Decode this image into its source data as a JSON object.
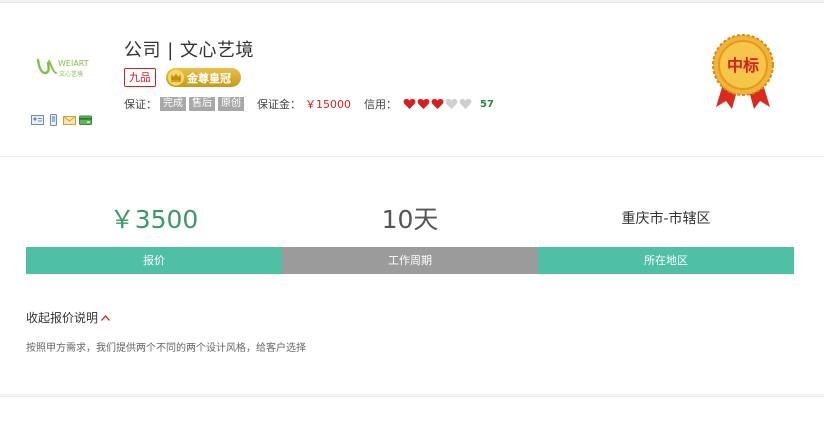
{
  "company": {
    "title": "公司 | 文心艺境",
    "logo_text": "WEIART",
    "logo_subtext": "文心艺境",
    "rank_badge": "九品",
    "crown_badge": "金尊皇冠",
    "icons": [
      "id-card-icon",
      "phone-icon",
      "email-icon",
      "bank-card-icon"
    ]
  },
  "guarantee": {
    "label": "保证：",
    "tags": [
      "完成",
      "售后",
      "原创"
    ]
  },
  "deposit": {
    "label": "保证金：",
    "value": "￥15000"
  },
  "credit": {
    "label": "信用：",
    "filled_hearts": 3,
    "total_hearts": 5,
    "score": "57"
  },
  "medal": {
    "text": "中标"
  },
  "stats": {
    "price": {
      "value": "￥3500",
      "label": "报价"
    },
    "period": {
      "value": "10天",
      "label": "工作周期"
    },
    "region": {
      "value": "重庆市-市辖区",
      "label": "所在地区"
    }
  },
  "details": {
    "toggle_label": "收起报价说明",
    "description": "按照甲方需求，我们提供两个不同的两个设计风格，给客户选择"
  },
  "colors": {
    "accent_green": "#4fbfa6",
    "price_green": "#3a9a6b",
    "red": "#d62020",
    "gray_bar": "#9b9b9b",
    "gold": "#d4a72c"
  }
}
